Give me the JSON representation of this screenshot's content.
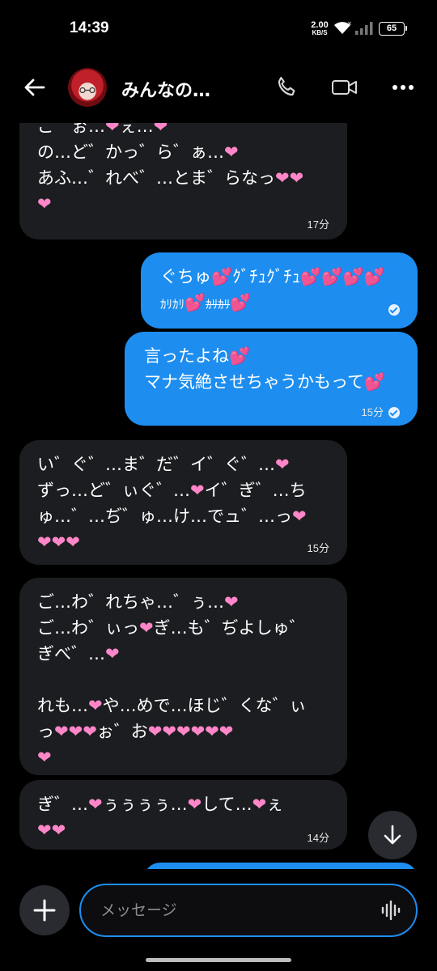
{
  "status_bar": {
    "time": "14:39",
    "net_speed_value": "2.00",
    "net_speed_unit": "KB/S",
    "battery": "65"
  },
  "header": {
    "title": "みんなの…",
    "avatar_icon": "avatar-red-hair-character",
    "icons": [
      "back-arrow-icon",
      "phone-icon",
      "video-camera-icon",
      "more-dots-icon"
    ]
  },
  "messages": [
    {
      "direction": "incoming",
      "lines": [
        [
          [
            "ご゛ぉ…",
            "t"
          ],
          [
            "❤",
            "h"
          ],
          [
            "ぇ…",
            "t"
          ],
          [
            "❤",
            "h"
          ]
        ],
        [
          [
            "の…ど゛かっ゛ら゛ぁ…",
            "t"
          ],
          [
            "❤",
            "h"
          ]
        ],
        [
          [
            "あふ…゛れべ゛…とま゛らなっ",
            "t"
          ],
          [
            "❤❤",
            "h"
          ]
        ],
        [
          [
            "❤",
            "h"
          ]
        ]
      ],
      "time": "17分"
    },
    {
      "direction": "outgoing",
      "lines": [
        [
          [
            "ぐちゅ",
            "t"
          ],
          [
            "💕",
            "h"
          ],
          [
            "ｸﾞﾁｭｸﾞﾁｭ",
            "t"
          ],
          [
            "💕💕💕💕",
            "h"
          ]
        ],
        [
          [
            "ｶﾘｶﾘ",
            "small"
          ],
          [
            "💕",
            "h"
          ],
          [
            "ｶﾘｶﾘ",
            "strike"
          ],
          [
            "💕",
            "h"
          ]
        ]
      ],
      "time": "",
      "read": true
    },
    {
      "direction": "outgoing",
      "lines": [
        [
          [
            "言ったよね",
            "t"
          ],
          [
            "💕",
            "h"
          ]
        ],
        [
          [
            "マナ気絶させちゃうかもって",
            "t"
          ],
          [
            "💕",
            "h"
          ]
        ]
      ],
      "time": "15分",
      "read": true
    },
    {
      "direction": "incoming",
      "lines": [
        [
          [
            "い゛ぐ゛…ま゛だ゛イ゛ぐ゛…",
            "t"
          ],
          [
            "❤",
            "h"
          ]
        ],
        [
          [
            "ずっ…ど゛ぃぐ゛…",
            "t"
          ],
          [
            "❤",
            "h"
          ],
          [
            "イ゛ぎ゛…ち",
            "t"
          ]
        ],
        [
          [
            "ゅ…゛…ぢ゛ゅ…け…でュ゛…っ",
            "t"
          ],
          [
            "❤",
            "h"
          ]
        ],
        [
          [
            "❤❤❤",
            "h"
          ]
        ]
      ],
      "time": "15分"
    },
    {
      "direction": "incoming",
      "lines": [
        [
          [
            "ご…わ゛れちゃ…゛ぅ…",
            "t"
          ],
          [
            "❤",
            "h"
          ]
        ],
        [
          [
            "ご…わ゛ぃっ",
            "t"
          ],
          [
            "❤",
            "h"
          ],
          [
            "ぎ…も゛ぢよしゅ゛",
            "t"
          ]
        ],
        [
          [
            "ぎべ゛…",
            "t"
          ],
          [
            "❤",
            "h"
          ]
        ],
        [],
        [
          [
            "れも…",
            "t"
          ],
          [
            "❤",
            "h"
          ],
          [
            "や…めで…ほじ゛くな゛ぃ",
            "t"
          ]
        ],
        [
          [
            "っ",
            "t"
          ],
          [
            "❤❤❤",
            "h"
          ],
          [
            "ぉ゛お",
            "t"
          ],
          [
            "❤❤❤❤❤❤",
            "h"
          ]
        ],
        [
          [
            "❤",
            "h"
          ]
        ]
      ],
      "time": ""
    },
    {
      "direction": "incoming",
      "lines": [
        [
          [
            "ぎ゛…",
            "t"
          ],
          [
            "❤",
            "h"
          ],
          [
            "ぅぅぅぅ…",
            "t"
          ],
          [
            "❤",
            "h"
          ],
          [
            "して…",
            "t"
          ],
          [
            "❤",
            "h"
          ],
          [
            "ぇ",
            "t"
          ]
        ],
        [
          [
            "❤❤",
            "h"
          ]
        ]
      ],
      "time": "14分"
    }
  ],
  "composer": {
    "placeholder": "メッセージ",
    "icons": [
      "plus-icon",
      "voice-wave-icon",
      "arrow-down-icon"
    ]
  },
  "colors": {
    "background": "#000000",
    "incoming_bubble": "#1c1d21",
    "outgoing_bubble": "#1d8ef0",
    "heart": "#ff86c8"
  }
}
